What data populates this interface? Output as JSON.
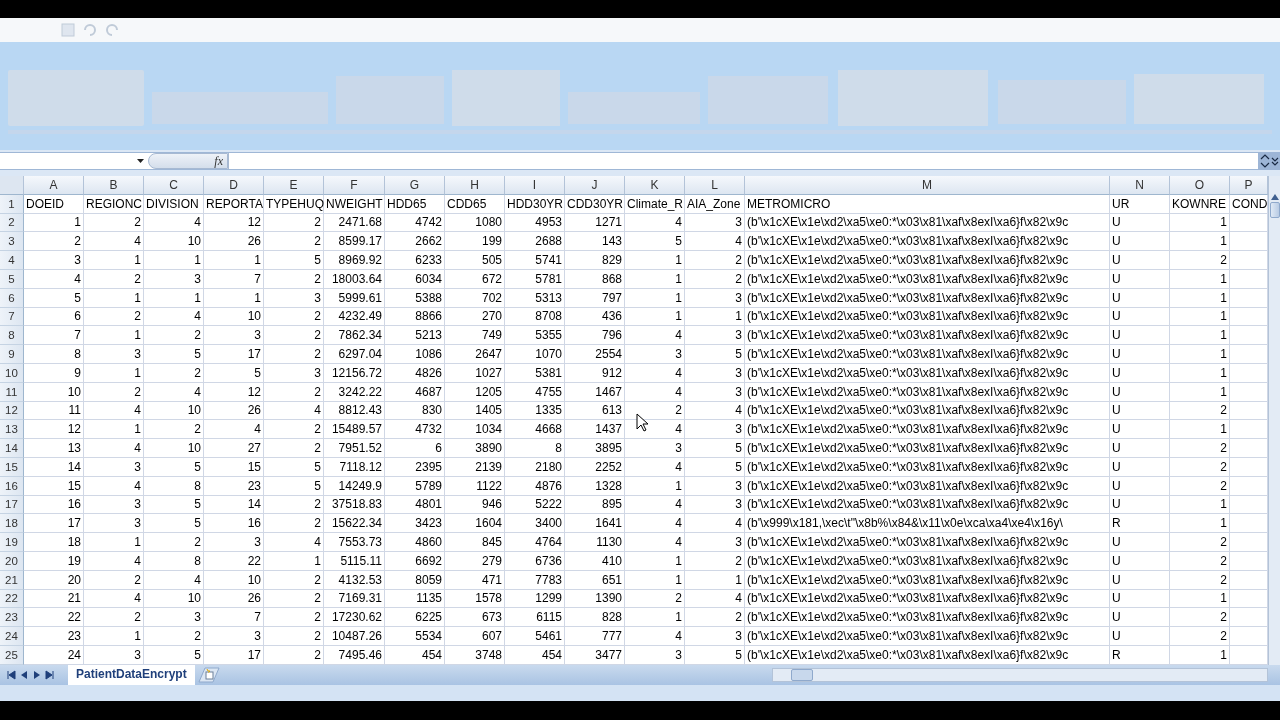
{
  "formula_bar": {
    "fx_label": "fx"
  },
  "columns": [
    "A",
    "B",
    "C",
    "D",
    "E",
    "F",
    "G",
    "H",
    "I",
    "J",
    "K",
    "L",
    "M",
    "N",
    "O",
    "P"
  ],
  "rows": [
    {
      "number": "1",
      "cells": [
        "DOEID",
        "REGIONC",
        "DIVISION",
        "REPORTA",
        "TYPEHUQ",
        "NWEIGHT",
        "HDD65",
        "CDD65",
        "HDD30YR",
        "CDD30YR",
        "Climate_R",
        "AIA_Zone",
        "METROMICRO",
        "UR",
        "KOWNRE",
        "COND"
      ]
    },
    {
      "number": "2",
      "cells": [
        "1",
        "2",
        "4",
        "12",
        "2",
        "2471.68",
        "4742",
        "1080",
        "4953",
        "1271",
        "4",
        "3",
        "(b'\\x1cXE\\x1e\\xd2\\xa5\\xe0:*\\x03\\x81\\xaf\\x8exI\\xa6}f\\x82\\x9c",
        "U",
        "1"
      ]
    },
    {
      "number": "3",
      "cells": [
        "2",
        "4",
        "10",
        "26",
        "2",
        "8599.17",
        "2662",
        "199",
        "2688",
        "143",
        "5",
        "4",
        "(b'\\x1cXE\\x1e\\xd2\\xa5\\xe0:*\\x03\\x81\\xaf\\x8exI\\xa6}f\\x82\\x9c",
        "U",
        "1"
      ]
    },
    {
      "number": "4",
      "cells": [
        "3",
        "1",
        "1",
        "1",
        "5",
        "8969.92",
        "6233",
        "505",
        "5741",
        "829",
        "1",
        "2",
        "(b'\\x1cXE\\x1e\\xd2\\xa5\\xe0:*\\x03\\x81\\xaf\\x8exI\\xa6}f\\x82\\x9c",
        "U",
        "2"
      ]
    },
    {
      "number": "5",
      "cells": [
        "4",
        "2",
        "3",
        "7",
        "2",
        "18003.64",
        "6034",
        "672",
        "5781",
        "868",
        "1",
        "2",
        "(b'\\x1cXE\\x1e\\xd2\\xa5\\xe0:*\\x03\\x81\\xaf\\x8exI\\xa6}f\\x82\\x9c",
        "U",
        "1"
      ]
    },
    {
      "number": "6",
      "cells": [
        "5",
        "1",
        "1",
        "1",
        "3",
        "5999.61",
        "5388",
        "702",
        "5313",
        "797",
        "1",
        "3",
        "(b'\\x1cXE\\x1e\\xd2\\xa5\\xe0:*\\x03\\x81\\xaf\\x8exI\\xa6}f\\x82\\x9c",
        "U",
        "1"
      ]
    },
    {
      "number": "7",
      "cells": [
        "6",
        "2",
        "4",
        "10",
        "2",
        "4232.49",
        "8866",
        "270",
        "8708",
        "436",
        "1",
        "1",
        "(b'\\x1cXE\\x1e\\xd2\\xa5\\xe0:*\\x03\\x81\\xaf\\x8exI\\xa6}f\\x82\\x9c",
        "U",
        "1"
      ]
    },
    {
      "number": "8",
      "cells": [
        "7",
        "1",
        "2",
        "3",
        "2",
        "7862.34",
        "5213",
        "749",
        "5355",
        "796",
        "4",
        "3",
        "(b'\\x1cXE\\x1e\\xd2\\xa5\\xe0:*\\x03\\x81\\xaf\\x8exI\\xa6}f\\x82\\x9c",
        "U",
        "1"
      ]
    },
    {
      "number": "9",
      "cells": [
        "8",
        "3",
        "5",
        "17",
        "2",
        "6297.04",
        "1086",
        "2647",
        "1070",
        "2554",
        "3",
        "5",
        "(b'\\x1cXE\\x1e\\xd2\\xa5\\xe0:*\\x03\\x81\\xaf\\x8exI\\xa6}f\\x82\\x9c",
        "U",
        "1"
      ]
    },
    {
      "number": "10",
      "cells": [
        "9",
        "1",
        "2",
        "5",
        "3",
        "12156.72",
        "4826",
        "1027",
        "5381",
        "912",
        "4",
        "3",
        "(b'\\x1cXE\\x1e\\xd2\\xa5\\xe0:*\\x03\\x81\\xaf\\x8exI\\xa6}f\\x82\\x9c",
        "U",
        "1"
      ]
    },
    {
      "number": "11",
      "cells": [
        "10",
        "2",
        "4",
        "12",
        "2",
        "3242.22",
        "4687",
        "1205",
        "4755",
        "1467",
        "4",
        "3",
        "(b'\\x1cXE\\x1e\\xd2\\xa5\\xe0:*\\x03\\x81\\xaf\\x8exI\\xa6}f\\x82\\x9c",
        "U",
        "1"
      ]
    },
    {
      "number": "12",
      "cells": [
        "11",
        "4",
        "10",
        "26",
        "4",
        "8812.43",
        "830",
        "1405",
        "1335",
        "613",
        "2",
        "4",
        "(b'\\x1cXE\\x1e\\xd2\\xa5\\xe0:*\\x03\\x81\\xaf\\x8exI\\xa6}f\\x82\\x9c",
        "U",
        "2"
      ]
    },
    {
      "number": "13",
      "cells": [
        "12",
        "1",
        "2",
        "4",
        "2",
        "15489.57",
        "4732",
        "1034",
        "4668",
        "1437",
        "4",
        "3",
        "(b'\\x1cXE\\x1e\\xd2\\xa5\\xe0:*\\x03\\x81\\xaf\\x8exI\\xa6}f\\x82\\x9c",
        "U",
        "1"
      ]
    },
    {
      "number": "14",
      "cells": [
        "13",
        "4",
        "10",
        "27",
        "2",
        "7951.52",
        "6",
        "3890",
        "8",
        "3895",
        "3",
        "5",
        "(b'\\x1cXE\\x1e\\xd2\\xa5\\xe0:*\\x03\\x81\\xaf\\x8exI\\xa6}f\\x82\\x9c",
        "U",
        "2"
      ]
    },
    {
      "number": "15",
      "cells": [
        "14",
        "3",
        "5",
        "15",
        "5",
        "7118.12",
        "2395",
        "2139",
        "2180",
        "2252",
        "4",
        "5",
        "(b'\\x1cXE\\x1e\\xd2\\xa5\\xe0:*\\x03\\x81\\xaf\\x8exI\\xa6}f\\x82\\x9c",
        "U",
        "2"
      ]
    },
    {
      "number": "16",
      "cells": [
        "15",
        "4",
        "8",
        "23",
        "5",
        "14249.9",
        "5789",
        "1122",
        "4876",
        "1328",
        "1",
        "3",
        "(b'\\x1cXE\\x1e\\xd2\\xa5\\xe0:*\\x03\\x81\\xaf\\x8exI\\xa6}f\\x82\\x9c",
        "U",
        "2"
      ]
    },
    {
      "number": "17",
      "cells": [
        "16",
        "3",
        "5",
        "14",
        "2",
        "37518.83",
        "4801",
        "946",
        "5222",
        "895",
        "4",
        "3",
        "(b'\\x1cXE\\x1e\\xd2\\xa5\\xe0:*\\x03\\x81\\xaf\\x8exI\\xa6}f\\x82\\x9c",
        "U",
        "1"
      ]
    },
    {
      "number": "18",
      "cells": [
        "17",
        "3",
        "5",
        "16",
        "2",
        "15622.34",
        "3423",
        "1604",
        "3400",
        "1641",
        "4",
        "4",
        "(b'\\x999\\x181,\\xec\\t\"\\x8b%\\x84&\\x11\\x0e\\xca\\xa4\\xe4\\x16y\\",
        "R",
        "1"
      ]
    },
    {
      "number": "19",
      "cells": [
        "18",
        "1",
        "2",
        "3",
        "4",
        "7553.73",
        "4860",
        "845",
        "4764",
        "1130",
        "4",
        "3",
        "(b'\\x1cXE\\x1e\\xd2\\xa5\\xe0:*\\x03\\x81\\xaf\\x8exI\\xa6}f\\x82\\x9c",
        "U",
        "2"
      ]
    },
    {
      "number": "20",
      "cells": [
        "19",
        "4",
        "8",
        "22",
        "1",
        "5115.11",
        "6692",
        "279",
        "6736",
        "410",
        "1",
        "2",
        "(b'\\x1cXE\\x1e\\xd2\\xa5\\xe0:*\\x03\\x81\\xaf\\x8exI\\xa6}f\\x82\\x9c",
        "U",
        "2"
      ]
    },
    {
      "number": "21",
      "cells": [
        "20",
        "2",
        "4",
        "10",
        "2",
        "4132.53",
        "8059",
        "471",
        "7783",
        "651",
        "1",
        "1",
        "(b'\\x1cXE\\x1e\\xd2\\xa5\\xe0:*\\x03\\x81\\xaf\\x8exI\\xa6}f\\x82\\x9c",
        "U",
        "2"
      ]
    },
    {
      "number": "22",
      "cells": [
        "21",
        "4",
        "10",
        "26",
        "2",
        "7169.31",
        "1135",
        "1578",
        "1299",
        "1390",
        "2",
        "4",
        "(b'\\x1cXE\\x1e\\xd2\\xa5\\xe0:*\\x03\\x81\\xaf\\x8exI\\xa6}f\\x82\\x9c",
        "U",
        "1"
      ]
    },
    {
      "number": "23",
      "cells": [
        "22",
        "2",
        "3",
        "7",
        "2",
        "17230.62",
        "6225",
        "673",
        "6115",
        "828",
        "1",
        "2",
        "(b'\\x1cXE\\x1e\\xd2\\xa5\\xe0:*\\x03\\x81\\xaf\\x8exI\\xa6}f\\x82\\x9c",
        "U",
        "2"
      ]
    },
    {
      "number": "24",
      "cells": [
        "23",
        "1",
        "2",
        "3",
        "2",
        "10487.26",
        "5534",
        "607",
        "5461",
        "777",
        "4",
        "3",
        "(b'\\x1cXE\\x1e\\xd2\\xa5\\xe0:*\\x03\\x81\\xaf\\x8exI\\xa6}f\\x82\\x9c",
        "U",
        "2"
      ]
    },
    {
      "number": "25",
      "cells": [
        "24",
        "3",
        "5",
        "17",
        "2",
        "7495.46",
        "454",
        "3748",
        "454",
        "3477",
        "3",
        "5",
        "(b'\\x1cXE\\x1e\\xd2\\xa5\\xe0:*\\x03\\x81\\xaf\\x8exI\\xa6}f\\x82\\x9c",
        "R",
        "1"
      ]
    }
  ],
  "sheet_tabs": [
    {
      "label": "PatientDataEncrypt",
      "selected": true
    }
  ]
}
